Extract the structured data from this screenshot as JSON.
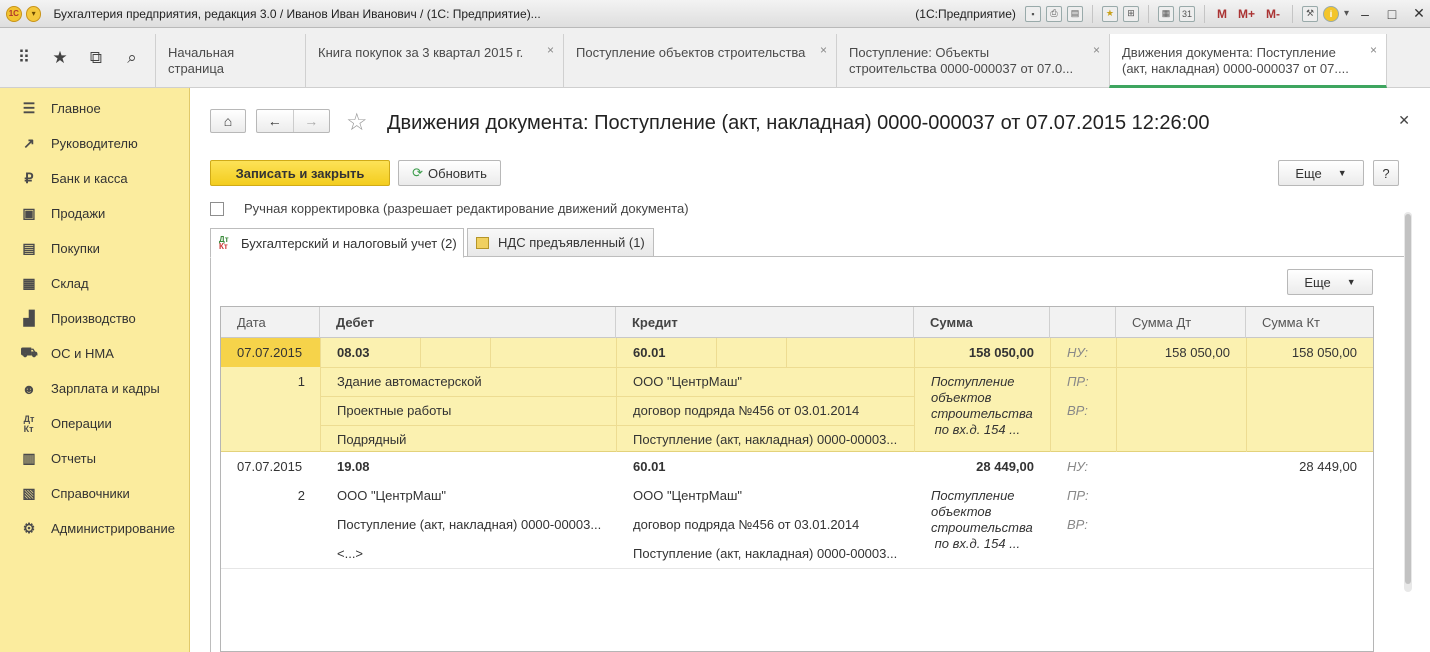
{
  "window": {
    "title": "Бухгалтерия предприятия, редакция 3.0 / Иванов Иван Иванович / (1С: Предприятие)...",
    "platform": "(1С:Предприятие)",
    "mem_buttons": [
      "M",
      "M+",
      "M-"
    ]
  },
  "tabs": [
    {
      "label": "Начальная страница"
    },
    {
      "label": "Книга покупок за 3 квартал 2015 г."
    },
    {
      "label": "Поступление объектов строительства"
    },
    {
      "label_line1": "Поступление: Объекты",
      "label_line2": "строительства 0000-000037 от 07.0..."
    },
    {
      "label_line1": "Движения документа: Поступление",
      "label_line2": "(акт, накладная) 0000-000037 от 07...."
    }
  ],
  "sidebar": {
    "items": [
      {
        "label": "Главное",
        "icon": "menu-icon"
      },
      {
        "label": "Руководителю",
        "icon": "trend-icon"
      },
      {
        "label": "Банк и касса",
        "icon": "ruble-icon"
      },
      {
        "label": "Продажи",
        "icon": "bag-icon"
      },
      {
        "label": "Покупки",
        "icon": "cart-icon"
      },
      {
        "label": "Склад",
        "icon": "warehouse-icon"
      },
      {
        "label": "Производство",
        "icon": "factory-icon"
      },
      {
        "label": "ОС и НМА",
        "icon": "truck-icon"
      },
      {
        "label": "Зарплата и кадры",
        "icon": "people-icon"
      },
      {
        "label": "Операции",
        "icon": "dt-kt-icon"
      },
      {
        "label": "Отчеты",
        "icon": "bar-chart-icon"
      },
      {
        "label": "Справочники",
        "icon": "book-icon"
      },
      {
        "label": "Администрирование",
        "icon": "gear-icon"
      }
    ]
  },
  "doc": {
    "title": "Движения документа: Поступление (акт, накладная) 0000-000037 от 07.07.2015 12:26:00",
    "save_close": "Записать и закрыть",
    "refresh": "Обновить",
    "more": "Еще",
    "help": "?",
    "manual_label": "Ручная корректировка (разрешает редактирование движений документа)"
  },
  "subtabs": [
    {
      "label": "Бухгалтерский и налоговый учет (2)"
    },
    {
      "label": "НДС предъявленный (1)"
    }
  ],
  "table": {
    "more": "Еще",
    "headers": {
      "date": "Дата",
      "debit": "Дебет",
      "credit": "Кредит",
      "sum": "Сумма",
      "sum_dt": "Сумма Дт",
      "sum_kt": "Сумма Кт"
    },
    "rows": [
      {
        "date": "07.07.2015",
        "num": "1",
        "debit_account": "08.03",
        "debit_sub": [
          "Здание автомастерской",
          "Проектные работы",
          "Подрядный"
        ],
        "credit_account": "60.01",
        "credit_sub": [
          "ООО \"ЦентрМаш\"",
          "договор подряда №456 от 03.01.2014",
          "Поступление (акт, накладная) 0000-00003..."
        ],
        "sum": "158 050,00",
        "content": [
          "Поступление",
          "объектов",
          "строительства",
          " по вх.д. 154 ..."
        ],
        "tax_labels": [
          "НУ:",
          "ПР:",
          "ВР:"
        ],
        "sum_dt": "158 050,00",
        "sum_kt": "158 050,00"
      },
      {
        "date": "07.07.2015",
        "num": "2",
        "debit_account": "19.08",
        "debit_sub": [
          "ООО \"ЦентрМаш\"",
          "Поступление (акт, накладная) 0000-00003...",
          "<...>"
        ],
        "credit_account": "60.01",
        "credit_sub": [
          "ООО \"ЦентрМаш\"",
          "договор подряда №456 от 03.01.2014",
          "Поступление (акт, накладная) 0000-00003..."
        ],
        "sum": "28 449,00",
        "content": [
          "Поступление",
          "объектов",
          "строительства",
          " по вх.д. 154 ..."
        ],
        "tax_labels": [
          "НУ:",
          "ПР:",
          "ВР:"
        ],
        "sum_dt": "",
        "sum_kt": "28 449,00"
      }
    ]
  }
}
